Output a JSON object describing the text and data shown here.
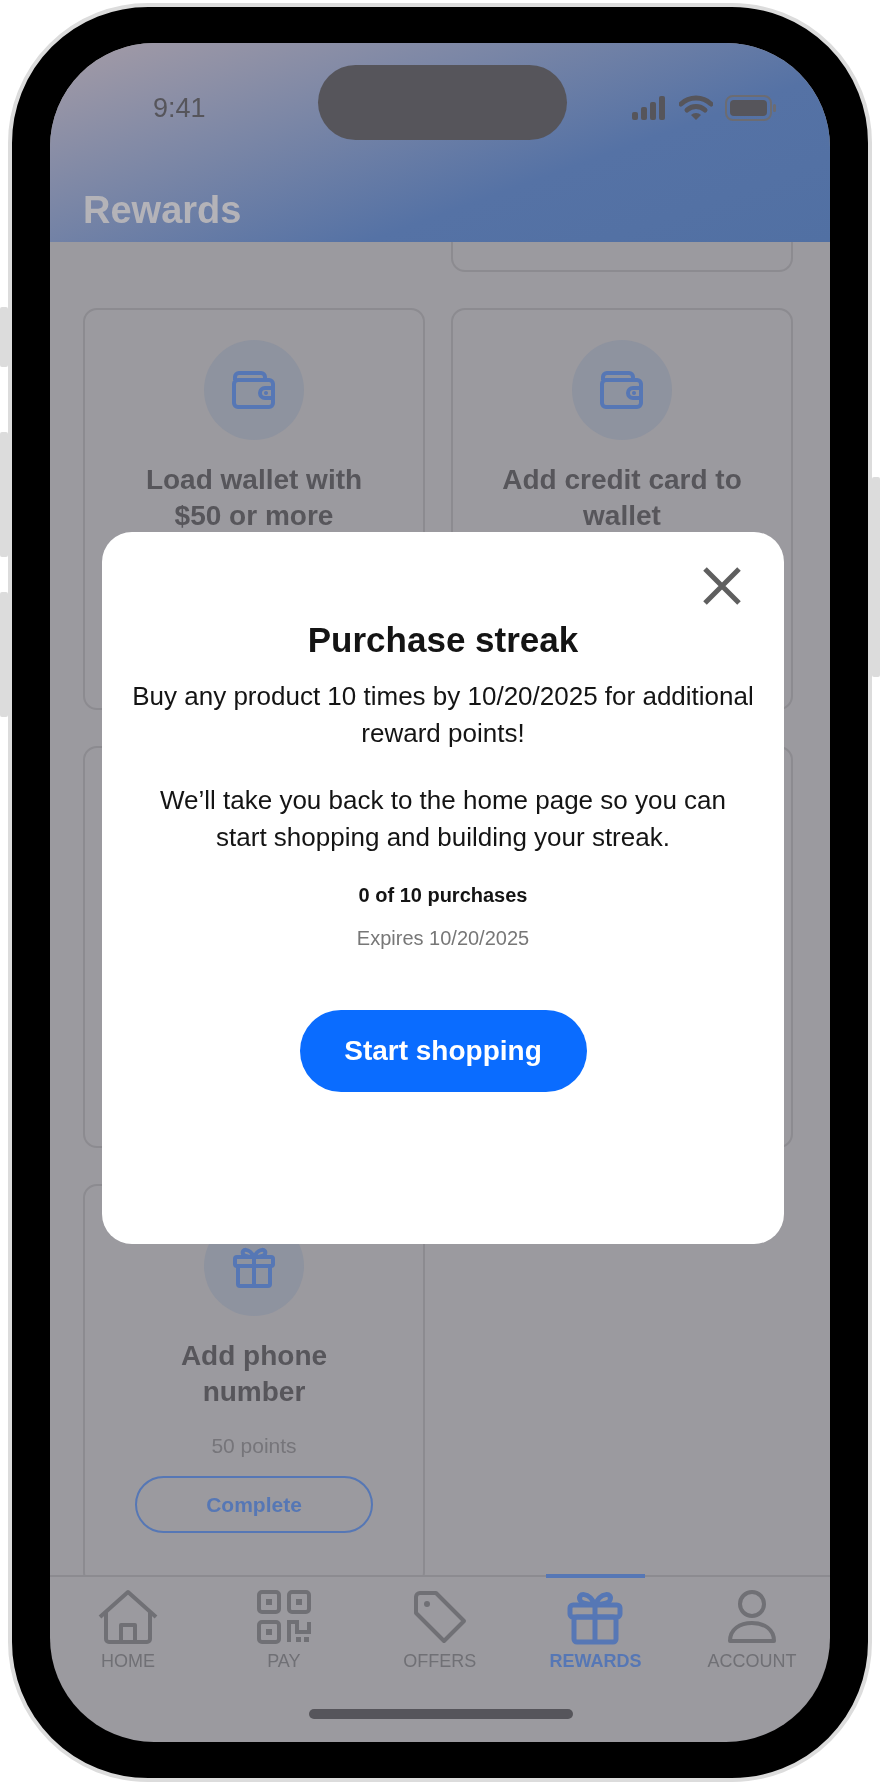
{
  "status_bar": {
    "time": "9:41"
  },
  "header": {
    "title": "Rewards"
  },
  "cards": [
    {
      "kind": "stub"
    },
    {
      "kind": "wallet",
      "title": "Load wallet with\n$50 or more"
    },
    {
      "kind": "wallet",
      "title": "Add credit card to\nwallet"
    },
    {
      "kind": "blank"
    },
    {
      "kind": "blank"
    },
    {
      "kind": "gift",
      "title": "Add phone\nnumber",
      "points": "50 points",
      "button": "Complete"
    }
  ],
  "modal": {
    "title": "Purchase streak",
    "paragraphs": [
      "Buy any product 10 times by 10/20/2025 for additional reward points!",
      "We’ll take you back to the home page so you can start shopping and building your streak."
    ],
    "progress": "0 of 10 purchases",
    "expires": "Expires 10/20/2025",
    "button": "Start shopping"
  },
  "tabs": [
    {
      "kind": "home",
      "label": "HOME",
      "selected": false
    },
    {
      "kind": "pay",
      "label": "PAY",
      "selected": false
    },
    {
      "kind": "offers",
      "label": "OFFERS",
      "selected": false
    },
    {
      "kind": "rewards",
      "label": "REWARDS",
      "selected": true
    },
    {
      "kind": "account",
      "label": "ACCOUNT",
      "selected": false
    }
  ]
}
